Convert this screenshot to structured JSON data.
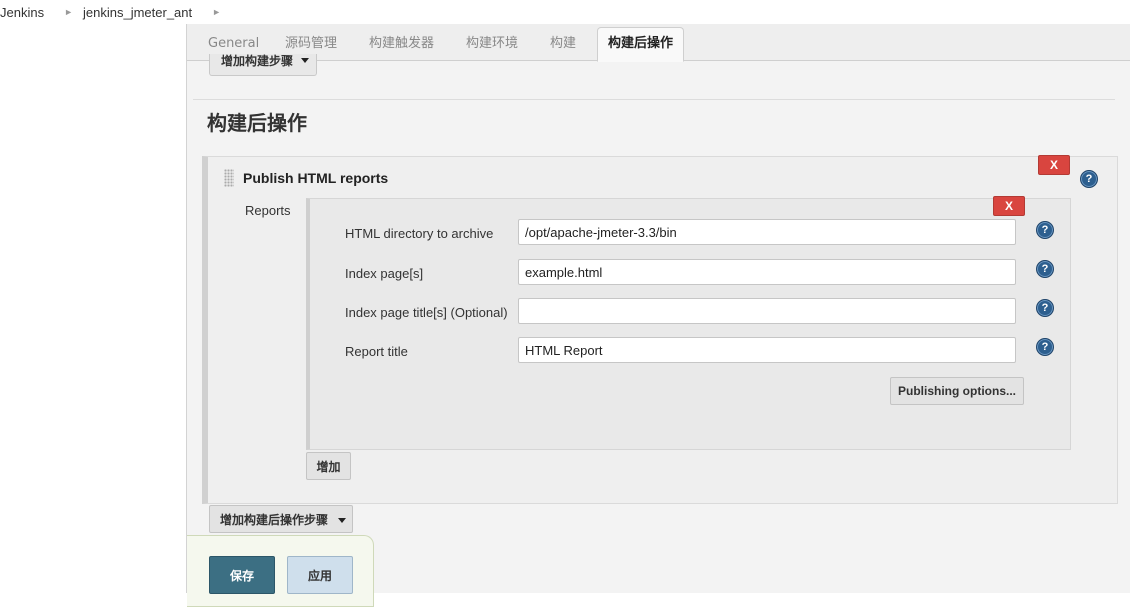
{
  "breadcrumb": {
    "items": [
      "Jenkins",
      "jenkins_jmeter_ant"
    ],
    "separator_icon": "chevron-right-icon"
  },
  "tabs": [
    {
      "label": "General",
      "active": false
    },
    {
      "label": "源码管理",
      "active": false
    },
    {
      "label": "构建触发器",
      "active": false
    },
    {
      "label": "构建环境",
      "active": false
    },
    {
      "label": "构建",
      "active": false
    },
    {
      "label": "构建后操作",
      "active": true
    }
  ],
  "add_build_step_label": "增加构建步骤",
  "section_title": "构建后操作",
  "publisher": {
    "title": "Publish HTML reports",
    "delete_label": "X",
    "reports_label": "Reports",
    "report": {
      "delete_label": "X",
      "fields": [
        {
          "label": "HTML directory to archive",
          "value": "/opt/apache-jmeter-3.3/bin"
        },
        {
          "label": "Index page[s]",
          "value": "example.html"
        },
        {
          "label": "Index page title[s] (Optional)",
          "value": ""
        },
        {
          "label": "Report title",
          "value": "HTML Report"
        }
      ],
      "publishing_options_label": "Publishing options..."
    },
    "add_label": "增加"
  },
  "add_post_build_step_label": "增加构建后操作步骤",
  "save_label": "保存",
  "apply_label": "应用",
  "help_label": "?",
  "colors": {
    "delete_red": "#d9453f",
    "save_blue": "#3c6f83",
    "help_blue": "#2d5f8f"
  }
}
